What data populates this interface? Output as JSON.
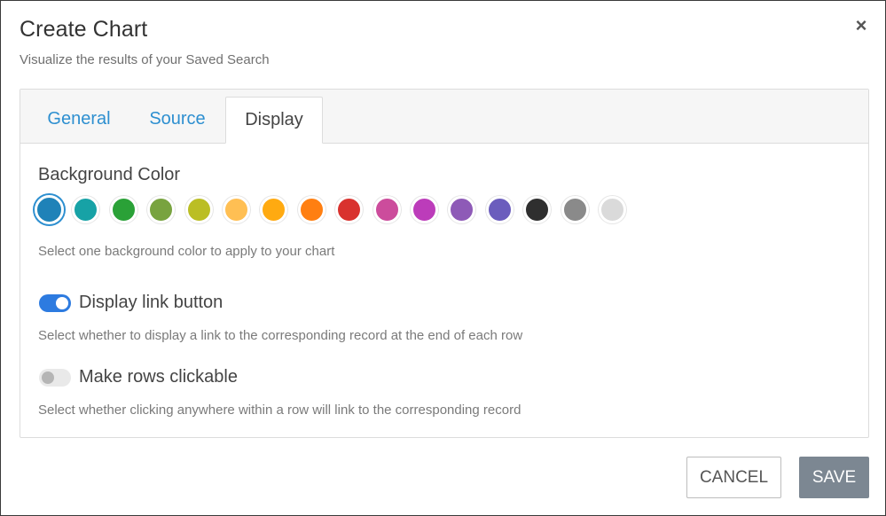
{
  "dialog": {
    "title": "Create Chart",
    "subtitle": "Visualize the results of your Saved Search",
    "close_symbol": "×",
    "close_icon": "close-icon"
  },
  "tabs": [
    {
      "label": "General",
      "active": false
    },
    {
      "label": "Source",
      "active": false
    },
    {
      "label": "Display",
      "active": true
    }
  ],
  "display": {
    "background_color_label": "Background Color",
    "background_color_help": "Select one background color to apply to your chart",
    "selected_color": "#1f82b8",
    "colors": [
      "#1f82b8",
      "#17a2a6",
      "#2aa137",
      "#78a33f",
      "#bbbe24",
      "#ffbf53",
      "#ffaa11",
      "#ff7f11",
      "#d9322e",
      "#cc4c9c",
      "#bc3cba",
      "#8e5ab7",
      "#6b5dbd",
      "#2f2f2f",
      "#8a8a8a",
      "#dadada"
    ],
    "link_button": {
      "label": "Display link button",
      "on": true,
      "help": "Select whether to display a link to the corresponding record at the end of each row"
    },
    "rows_clickable": {
      "label": "Make rows clickable",
      "on": false,
      "help": "Select whether clicking anywhere within a row will link to the corresponding record"
    }
  },
  "footer": {
    "cancel_label": "CANCEL",
    "save_label": "SAVE"
  }
}
